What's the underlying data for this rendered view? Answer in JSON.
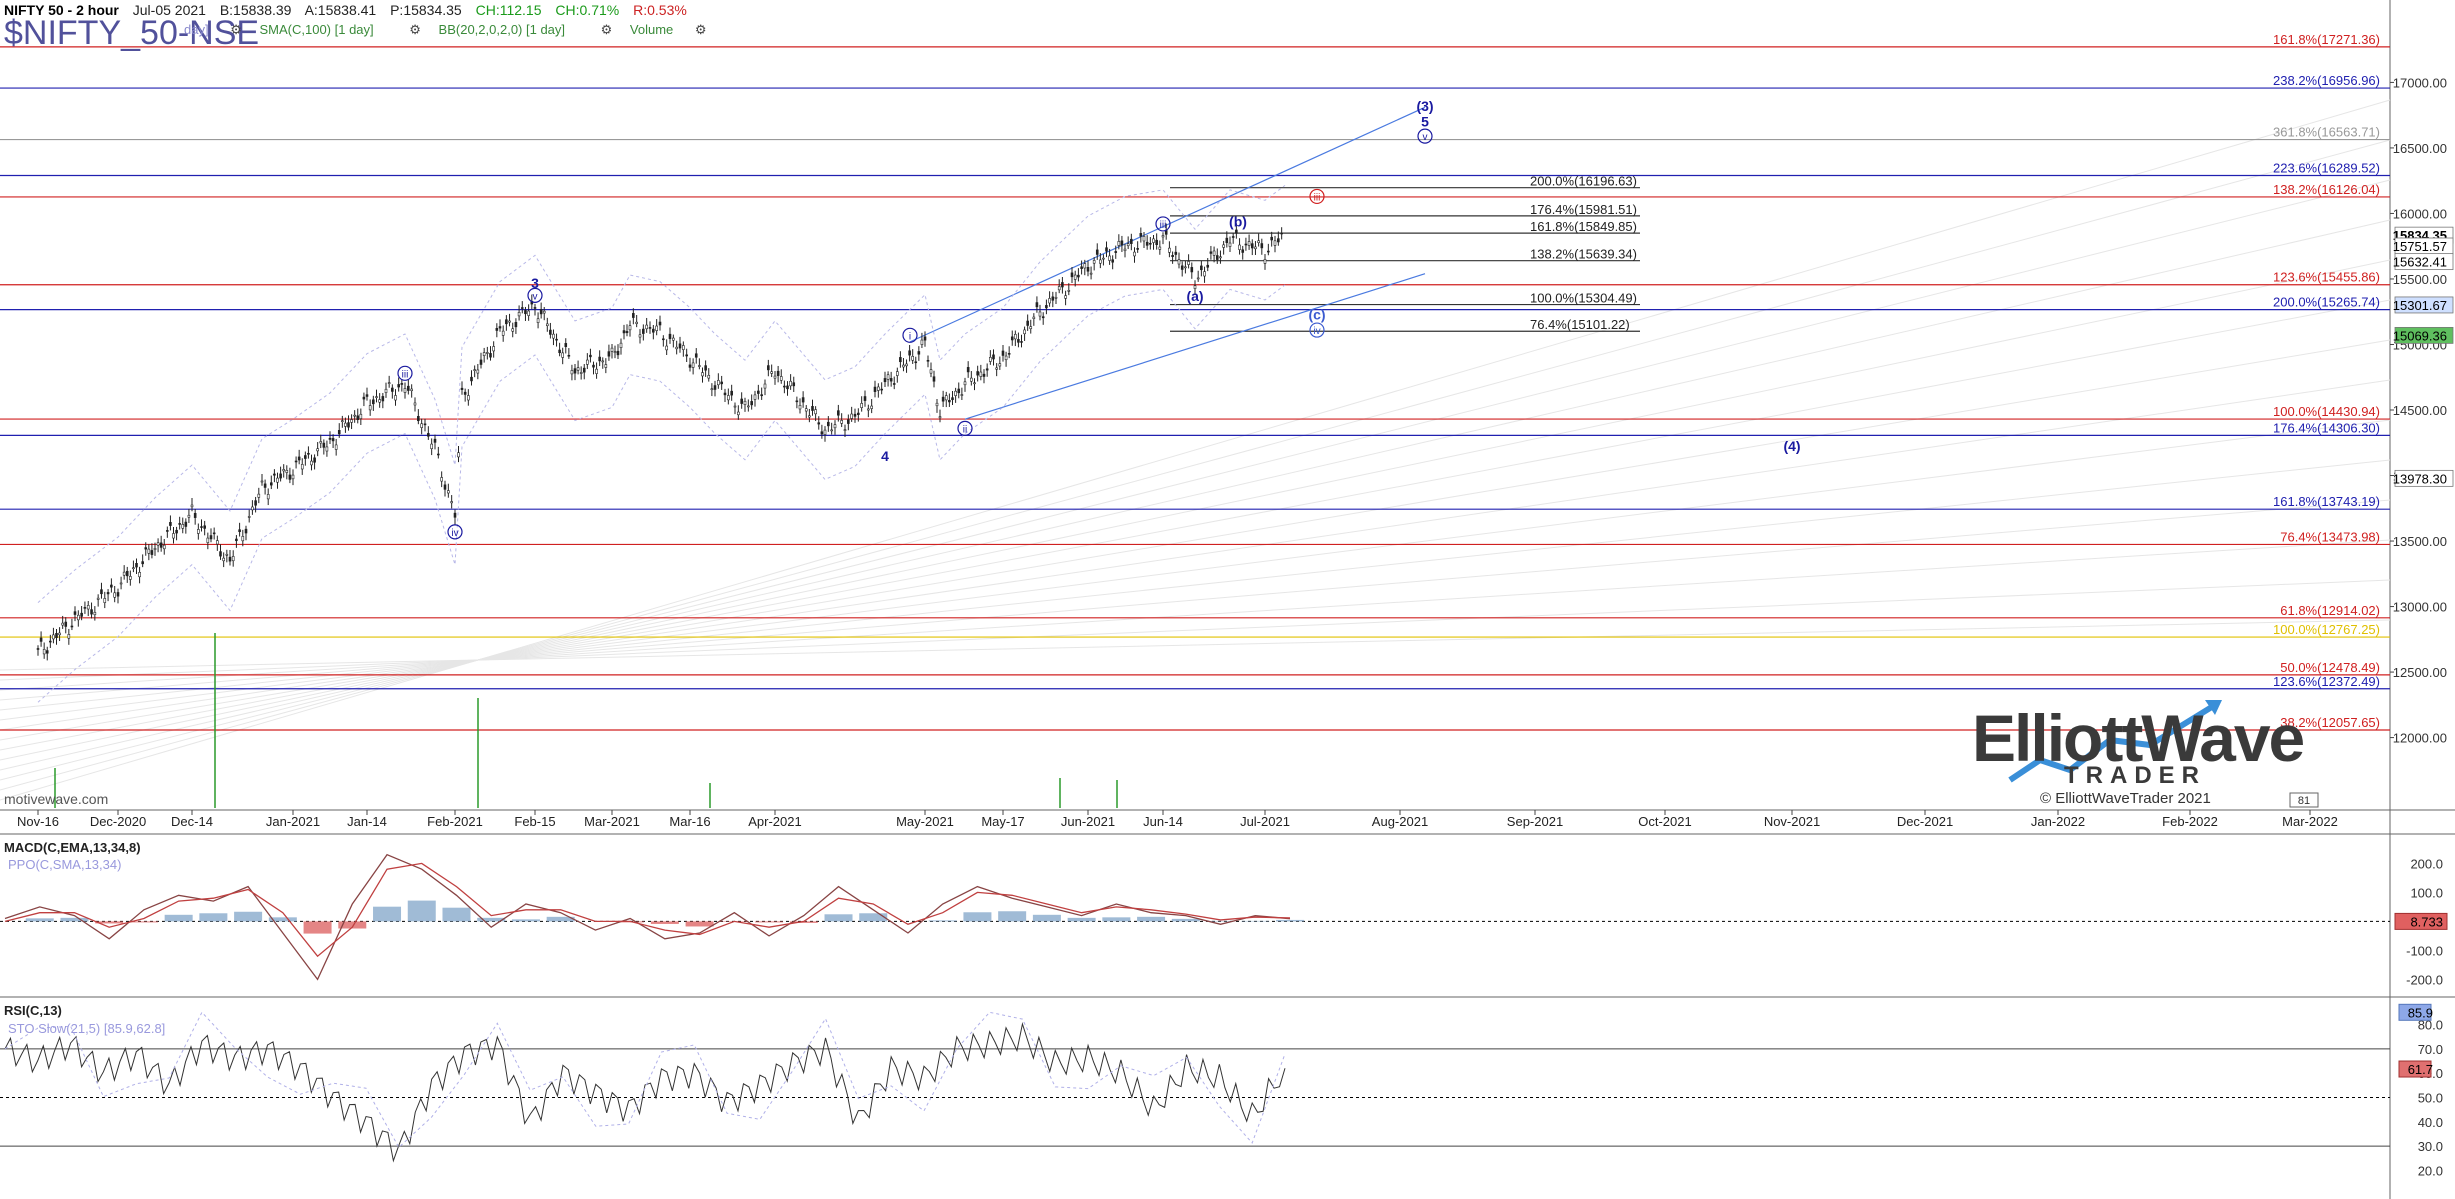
{
  "header": {
    "title": "NIFTY 50 - 2 hour",
    "date": "Jul-05 2021",
    "bid": "B:15838.39",
    "ask": "A:15838.41",
    "price": "P:15834.35",
    "change": "CH:112.15",
    "change_pct": "CH:0.71%",
    "range": "R:0.53%",
    "big_symbol": "$NIFTY_50-NSE",
    "indicators": [
      "SMA(C,100) [1 day]",
      "BB(20,2,0,2,0) [1 day]",
      "Volume"
    ],
    "partial_indicator": "day]"
  },
  "watermark": "motivewave.com",
  "logo": {
    "main": "ElliottWave",
    "sub": "TRADER",
    "copyright": "© ElliottWaveTrader 2021"
  },
  "colors": {
    "red_level": "#d02020",
    "blue_level": "#2020b0",
    "black_level": "#333333",
    "candle": "#222222",
    "wave_blue": "#1a1aa0",
    "volume": "#2a9a2a",
    "macd_hist": "#88aacc",
    "macd_neg": "#dd6666"
  },
  "chart_data": [
    {
      "type": "line",
      "title": "NIFTY 50 - 2 hour",
      "ylim": [
        11600,
        17400
      ],
      "y_ticks": [
        "17000.00",
        "16500.00",
        "16000.00",
        "15500.00",
        "15000.00",
        "14500.00",
        "14000.00",
        "13500.00",
        "13000.00",
        "12500.00",
        "12000.00"
      ],
      "x_ticks": [
        "Nov-16",
        "Dec-2020",
        "Dec-14",
        "Jan-2021",
        "Jan-14",
        "Feb-2021",
        "Feb-15",
        "Mar-2021",
        "Mar-16",
        "Apr-2021",
        "May-2021",
        "May-17",
        "Jun-2021",
        "Jun-14",
        "Jul-2021",
        "Aug-2021",
        "Sep-2021",
        "Oct-2021",
        "Nov-2021",
        "Dec-2021",
        "Jan-2022",
        "Feb-2022",
        "Mar-2022"
      ],
      "price_series": [
        [
          "Nov-16",
          12650
        ],
        [
          "Nov-23",
          12900
        ],
        [
          "Dec-2020",
          13150
        ],
        [
          "Dec-07",
          13450
        ],
        [
          "Dec-14",
          13700
        ],
        [
          "Dec-21",
          13350
        ],
        [
          "Dec-28",
          13900
        ],
        [
          "Jan-2021",
          14050
        ],
        [
          "Jan-07",
          14250
        ],
        [
          "Jan-14",
          14550
        ],
        [
          "Jan-21",
          14700
        ],
        [
          "Jan-27",
          14200
        ],
        [
          "Feb-2021",
          13700
        ],
        [
          "Feb-03",
          14600
        ],
        [
          "Feb-09",
          15100
        ],
        [
          "Feb-15",
          15300
        ],
        [
          "Feb-22",
          14800
        ],
        [
          "Mar-2021",
          14900
        ],
        [
          "Mar-04",
          15150
        ],
        [
          "Mar-10",
          15100
        ],
        [
          "Mar-16",
          14900
        ],
        [
          "Mar-22",
          14700
        ],
        [
          "Mar-30",
          14500
        ],
        [
          "Apr-2021",
          14800
        ],
        [
          "Apr-12",
          14350
        ],
        [
          "Apr-19",
          14450
        ],
        [
          "Apr-26",
          14700
        ],
        [
          "May-2021",
          15000
        ],
        [
          "May-05",
          14500
        ],
        [
          "May-12",
          14700
        ],
        [
          "May-17",
          14900
        ],
        [
          "May-24",
          15250
        ],
        [
          "Jun-2021",
          15600
        ],
        [
          "Jun-07",
          15750
        ],
        [
          "Jun-14",
          15800
        ],
        [
          "Jun-18",
          15500
        ],
        [
          "Jun-24",
          15800
        ],
        [
          "Jul-2021",
          15720
        ],
        [
          "Jul-05",
          15834
        ]
      ],
      "fib_levels": [
        {
          "label": "161.8%(17271.36)",
          "value": 17271.36,
          "color": "red"
        },
        {
          "label": "238.2%(16956.96)",
          "value": 16956.96,
          "color": "blue"
        },
        {
          "label": "361.8%(16563.71)",
          "value": 16563.71,
          "color": "gray"
        },
        {
          "label": "223.6%(16289.52)",
          "value": 16289.52,
          "color": "blue"
        },
        {
          "label": "138.2%(16126.04)",
          "value": 16126.04,
          "color": "red"
        },
        {
          "label": "123.6%(15455.86)",
          "value": 15455.86,
          "color": "red"
        },
        {
          "label": "200.0%(15265.74)",
          "value": 15265.74,
          "color": "blue"
        },
        {
          "label": "100.0%(14430.94)",
          "value": 14430.94,
          "color": "red"
        },
        {
          "label": "176.4%(14306.30)",
          "value": 14306.3,
          "color": "blue"
        },
        {
          "label": "161.8%(13743.19)",
          "value": 13743.19,
          "color": "blue"
        },
        {
          "label": "76.4%(13473.98)",
          "value": 13473.98,
          "color": "red"
        },
        {
          "label": "61.8%(12914.02)",
          "value": 12914.02,
          "color": "red"
        },
        {
          "label": "100.0%(12767.25)",
          "value": 12767.25,
          "color": "yellow"
        },
        {
          "label": "50.0%(12478.49)",
          "value": 12478.49,
          "color": "red"
        },
        {
          "label": "123.6%(12372.49)",
          "value": 12372.49,
          "color": "blue"
        },
        {
          "label": "38.2%(12057.65)",
          "value": 12057.65,
          "color": "red"
        }
      ],
      "local_levels": [
        {
          "label": "200.0%(16196.63)",
          "value": 16196.63
        },
        {
          "label": "176.4%(15981.51)",
          "value": 15981.51
        },
        {
          "label": "161.8%(15849.85)",
          "value": 15849.85
        },
        {
          "label": "138.2%(15639.34)",
          "value": 15639.34
        },
        {
          "label": "100.0%(15304.49)",
          "value": 15304.49
        },
        {
          "label": "76.4%(15101.22)",
          "value": 15101.22
        }
      ],
      "price_tags": [
        {
          "label": "15834.35",
          "value": 15834.35
        },
        {
          "label": "15751.57",
          "value": 15751.57
        },
        {
          "label": "15632.41",
          "value": 15632.41
        },
        {
          "label": "15301.67",
          "value": 15301.67
        },
        {
          "label": "15069.36",
          "value": 15069.36
        },
        {
          "label": "13978.30",
          "value": 13978.3
        }
      ],
      "wave_labels": [
        {
          "text": "3",
          "x": "Feb-15",
          "value": 15470
        },
        {
          "text": "v",
          "x": "Feb-15",
          "value": 15375
        },
        {
          "text": "iii",
          "x": "Jan-21",
          "value": 14780
        },
        {
          "text": "iv",
          "x": "Feb-2021",
          "value": 13570
        },
        {
          "text": "4",
          "x": "Apr-26",
          "value": 14150
        },
        {
          "text": "i",
          "x": "Apr-29",
          "value": 15070
        },
        {
          "text": "ii",
          "x": "May-12",
          "value": 14360
        },
        {
          "text": "iii",
          "x": "Jun-14",
          "value": 15920
        },
        {
          "text": "(a)",
          "x": "Jun-18",
          "value": 15370
        },
        {
          "text": "(b)",
          "x": "Jun-25",
          "value": 15940
        },
        {
          "text": "(c)",
          "x": "Jul-10",
          "value": 15230
        },
        {
          "text": "iv",
          "x": "Jul-10",
          "value": 15110
        },
        {
          "text": "iii",
          "x": "Jul-10",
          "value": 16130
        },
        {
          "text": "(3)",
          "x": "Jul-25",
          "value": 16820
        },
        {
          "text": "5",
          "x": "Jul-25",
          "value": 16700
        },
        {
          "text": "v",
          "x": "Jul-25",
          "value": 16590
        },
        {
          "text": "(4)",
          "x": "Nov-2021",
          "value": 14225
        }
      ],
      "last_price": 15834.35
    },
    {
      "type": "line",
      "title": "MACD(C,EMA,13,34,8)",
      "sub_label": "PPO(C,SMA,13,34)",
      "y_ticks": [
        "200.0",
        "100.0",
        "-100.0",
        "-200.0"
      ],
      "ylim": [
        -240,
        260
      ],
      "last_value": "8.733",
      "series": [
        {
          "name": "MACD",
          "values": [
            10,
            50,
            20,
            -60,
            40,
            90,
            70,
            120,
            -40,
            -200,
            60,
            230,
            180,
            90,
            -20,
            60,
            30,
            -30,
            10,
            -60,
            -40,
            30,
            -50,
            20,
            120,
            40,
            -40,
            60,
            120,
            80,
            50,
            20,
            60,
            30,
            20,
            -10,
            20,
            9
          ]
        },
        {
          "name": "Signal",
          "values": [
            0,
            30,
            30,
            -20,
            10,
            70,
            80,
            110,
            30,
            -120,
            -20,
            180,
            200,
            120,
            20,
            40,
            40,
            0,
            0,
            -30,
            -45,
            0,
            -20,
            0,
            80,
            60,
            -10,
            30,
            100,
            90,
            60,
            30,
            50,
            40,
            25,
            5,
            15,
            12
          ]
        }
      ]
    },
    {
      "type": "line",
      "title": "RSI(C,13)",
      "sub_label": "STO Slow(21,5) [85.9,62.8]",
      "y_ticks": [
        "80.0",
        "70.0",
        "60.0",
        "50.0",
        "40.0",
        "30.0",
        "20.0"
      ],
      "ylim": [
        12,
        88
      ],
      "last_value": "61.7",
      "other_value": "85.9",
      "series": [
        {
          "name": "RSI",
          "values": [
            70,
            65,
            72,
            60,
            68,
            55,
            72,
            66,
            70,
            62,
            50,
            40,
            28,
            55,
            68,
            72,
            40,
            60,
            52,
            45,
            58,
            60,
            48,
            55,
            64,
            70,
            40,
            62,
            58,
            70,
            72,
            75,
            64,
            66,
            60,
            45,
            62,
            58,
            42,
            62
          ]
        }
      ]
    }
  ]
}
